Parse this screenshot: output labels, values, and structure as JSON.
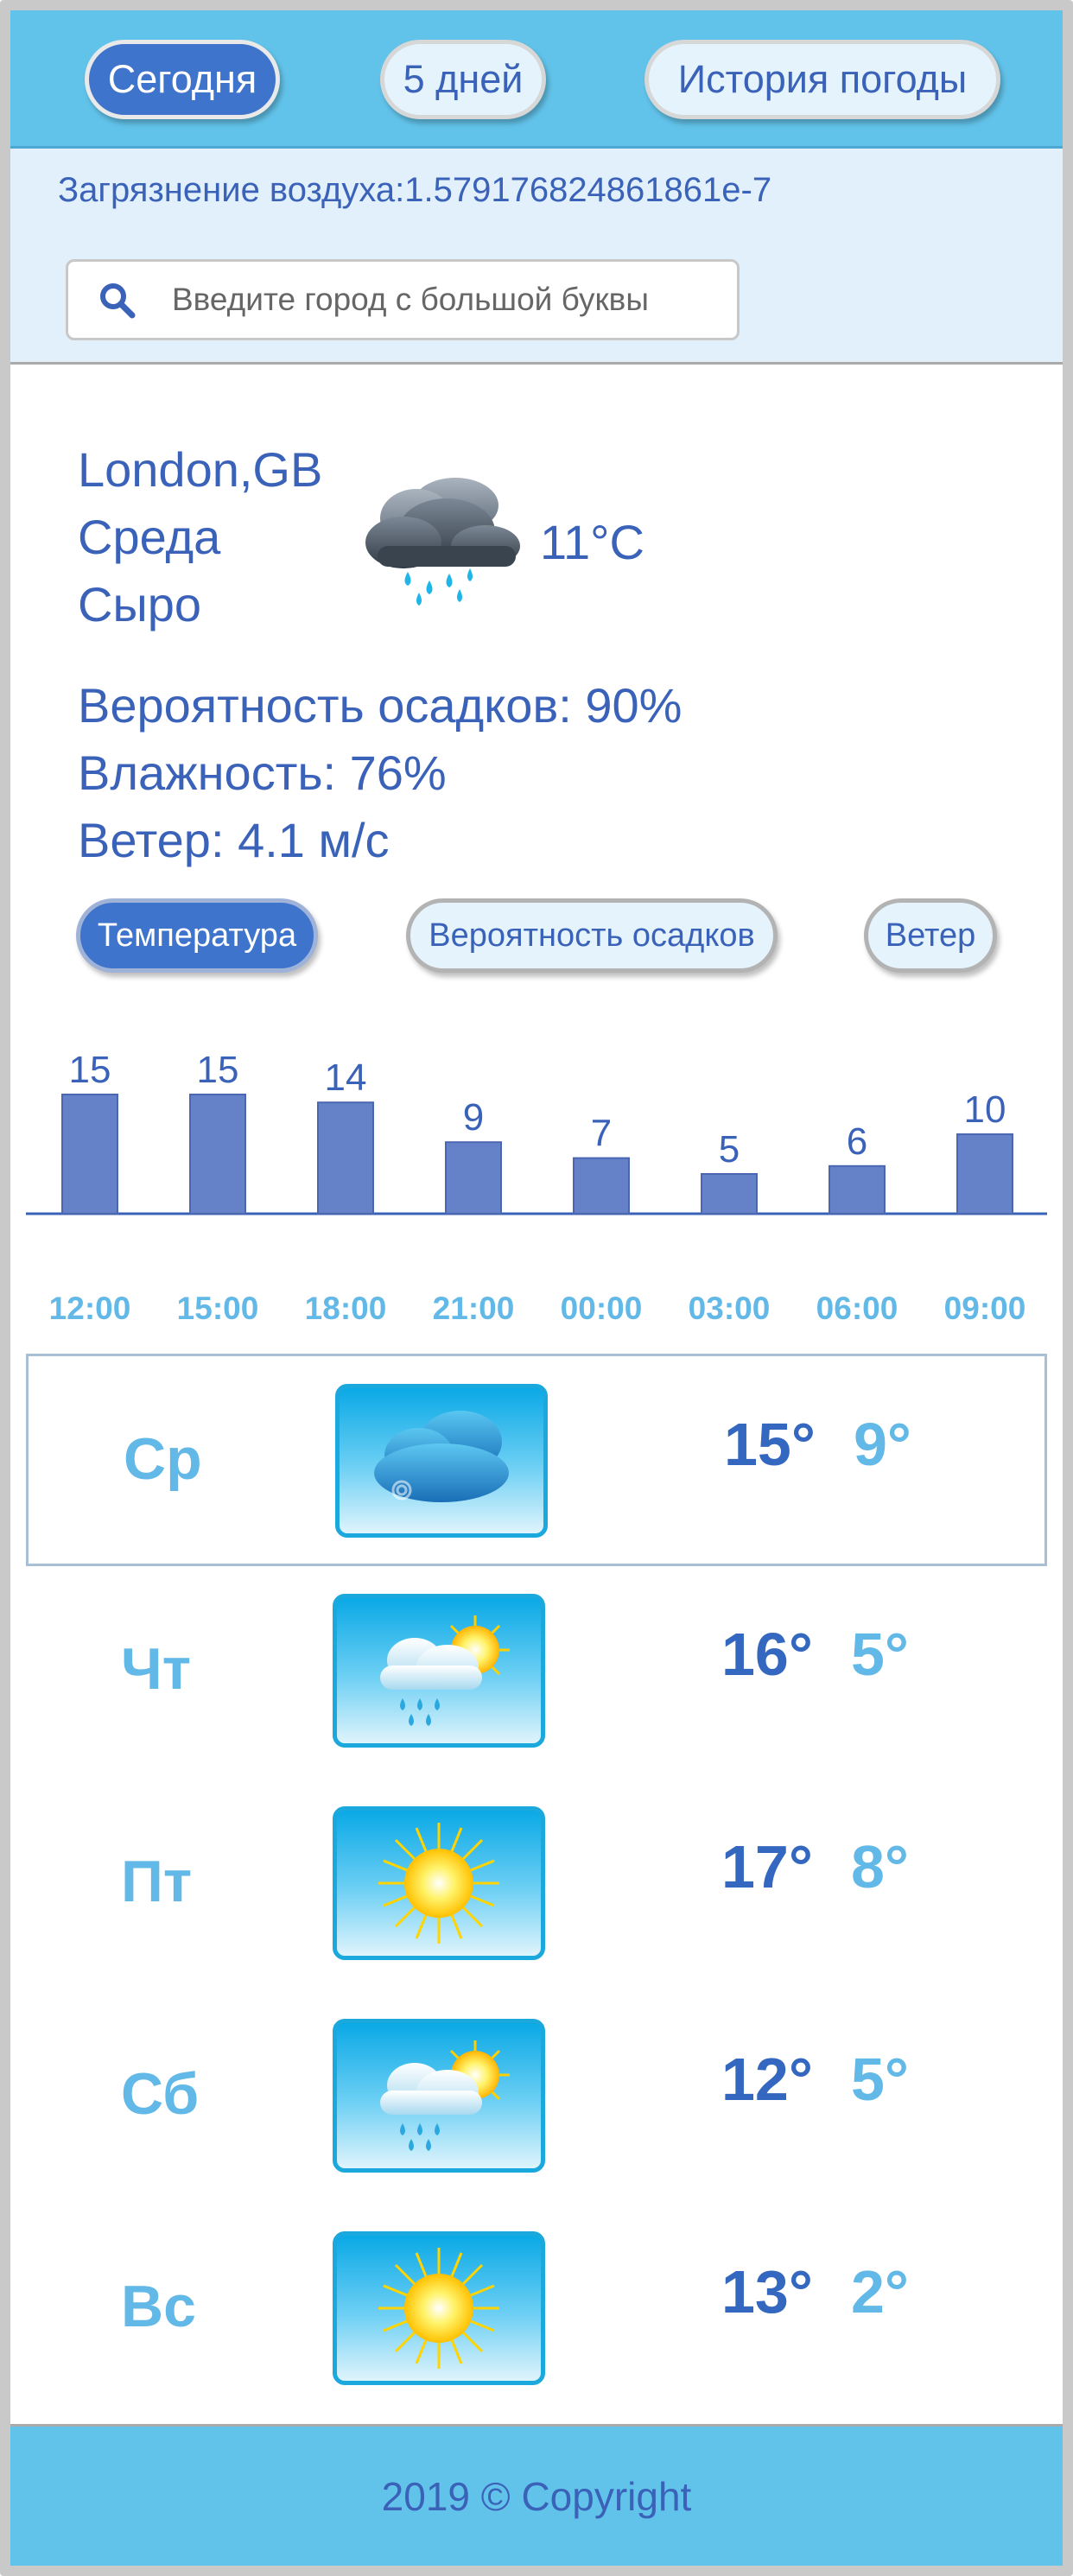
{
  "nav": {
    "today": "Сегодня",
    "five_days": "5 дней",
    "history": "История погоды"
  },
  "pollution": {
    "text": "Загрязнение воздуха:1.579176824861861e-7"
  },
  "search": {
    "placeholder": "Введите город с большой буквы",
    "value": ""
  },
  "current": {
    "city": "London,GB",
    "weekday": "Среда",
    "description": "Сыро",
    "temperature": "11°C",
    "icon": "rain-cloud-icon",
    "precipitation": "Вероятность осадков: 90%",
    "humidity": "Влажность: 76%",
    "wind": "Ветер: 4.1 м/с"
  },
  "tabs": {
    "temperature": "Температура",
    "precipitation": "Вероятность осадков",
    "wind": "Ветер"
  },
  "chart_data": {
    "type": "bar",
    "categories": [
      "12:00",
      "15:00",
      "18:00",
      "21:00",
      "00:00",
      "03:00",
      "06:00",
      "09:00"
    ],
    "values": [
      15,
      15,
      14,
      9,
      7,
      5,
      6,
      10
    ],
    "title": "",
    "xlabel": "",
    "ylabel": "",
    "ylim": [
      0,
      15
    ],
    "grid": false,
    "bar_color": "#6581c8",
    "label_color": "#3a62b8",
    "tick_color": "#62b8e6"
  },
  "forecast": [
    {
      "day": "Ср",
      "icon": "cloud-icon",
      "high": "15°",
      "low": "9°"
    },
    {
      "day": "Чт",
      "icon": "sun-cloud-rain-icon",
      "high": "16°",
      "low": "5°"
    },
    {
      "day": "Пт",
      "icon": "sun-icon",
      "high": "17°",
      "low": "8°"
    },
    {
      "day": "Сб",
      "icon": "sun-cloud-rain-icon",
      "high": "12°",
      "low": "5°"
    },
    {
      "day": "Вс",
      "icon": "sun-icon",
      "high": "13°",
      "low": "2°"
    }
  ],
  "footer": {
    "text": "2019 © Copyright"
  },
  "colors": {
    "header_bg": "#62c3ea",
    "accent": "#3f74cc",
    "text": "#3a62b8",
    "light_text": "#62b8e6"
  }
}
